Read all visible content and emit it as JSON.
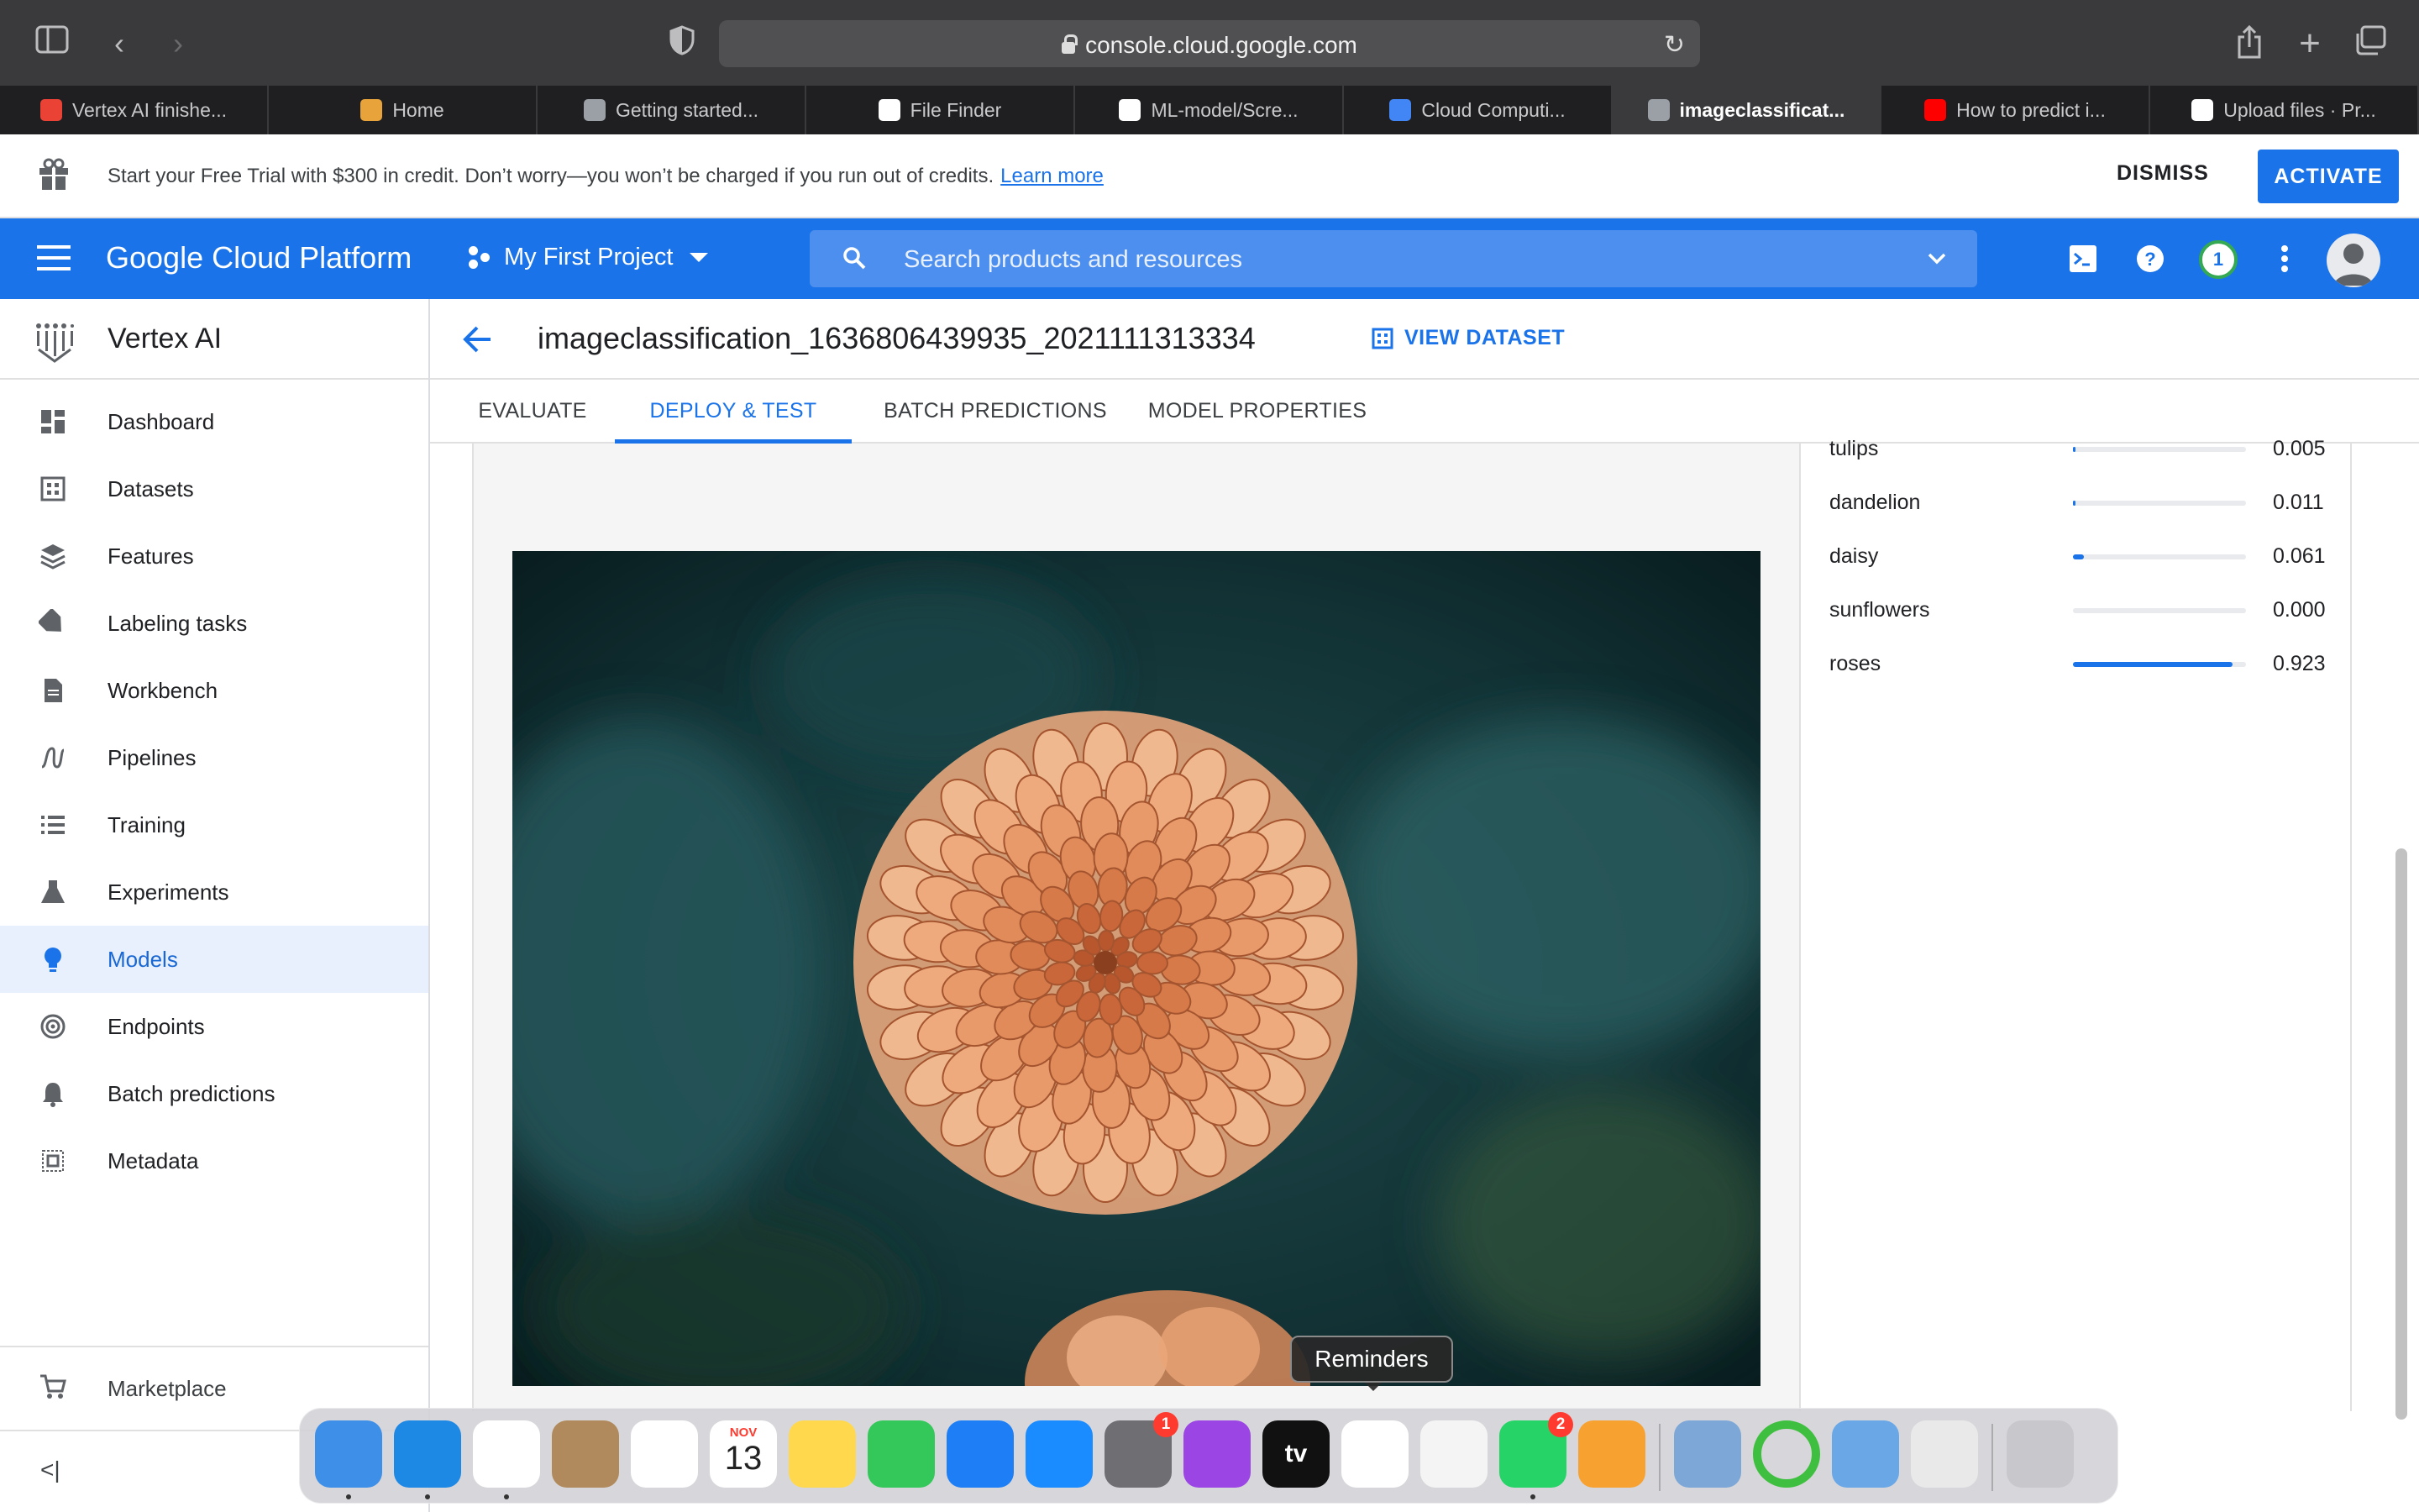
{
  "browser": {
    "url": "console.cloud.google.com",
    "tabs": [
      {
        "label": "Vertex AI finishe...",
        "icon": "gmail-icon",
        "color": "#ea4335"
      },
      {
        "label": "Home",
        "icon": "box-icon",
        "color": "#e8a33a"
      },
      {
        "label": "Getting started...",
        "icon": "gcp-hex-icon",
        "color": "#9aa0a6"
      },
      {
        "label": "File Finder",
        "icon": "github-icon",
        "color": "#ffffff"
      },
      {
        "label": "ML-model/Scre...",
        "icon": "github-icon",
        "color": "#ffffff"
      },
      {
        "label": "Cloud Computi...",
        "icon": "google-cloud-icon",
        "color": "#4285f4"
      },
      {
        "label": "imageclassificat...",
        "icon": "gcp-hex-icon",
        "color": "#9aa0a6",
        "active": true
      },
      {
        "label": "How to predict i...",
        "icon": "youtube-icon",
        "color": "#ff0000"
      },
      {
        "label": "Upload files · Pr...",
        "icon": "github-icon",
        "color": "#ffffff"
      }
    ]
  },
  "banner": {
    "text": "Start your Free Trial with $300 in credit. Don’t worry—you won’t be charged if you run out of credits.",
    "link": "Learn more",
    "dismiss": "DISMISS",
    "activate": "ACTIVATE"
  },
  "header": {
    "brand": "Google Cloud Platform",
    "project": "My First Project",
    "search_placeholder": "Search products and resources",
    "notifications": "1"
  },
  "sidebar": {
    "title": "Vertex AI",
    "items": [
      {
        "label": "Dashboard",
        "icon": "dashboard-icon"
      },
      {
        "label": "Datasets",
        "icon": "datasets-icon"
      },
      {
        "label": "Features",
        "icon": "features-icon"
      },
      {
        "label": "Labeling tasks",
        "icon": "label-icon"
      },
      {
        "label": "Workbench",
        "icon": "notebook-icon"
      },
      {
        "label": "Pipelines",
        "icon": "pipelines-icon"
      },
      {
        "label": "Training",
        "icon": "training-icon"
      },
      {
        "label": "Experiments",
        "icon": "flask-icon"
      },
      {
        "label": "Models",
        "icon": "lightbulb-icon",
        "active": true
      },
      {
        "label": "Endpoints",
        "icon": "endpoints-icon"
      },
      {
        "label": "Batch predictions",
        "icon": "bell-icon"
      },
      {
        "label": "Metadata",
        "icon": "metadata-icon"
      }
    ],
    "marketplace": "Marketplace",
    "collapse": "<|"
  },
  "model": {
    "title": "imageclassification_1636806439935_2021111313334",
    "view_dataset": "VIEW DATASET",
    "tabs": [
      "EVALUATE",
      "DEPLOY & TEST",
      "BATCH PREDICTIONS",
      "MODEL PROPERTIES"
    ],
    "active_tab": "DEPLOY & TEST"
  },
  "predictions": [
    {
      "label": "tulips",
      "value": "0.005",
      "score": 0.005
    },
    {
      "label": "dandelion",
      "value": "0.011",
      "score": 0.011
    },
    {
      "label": "daisy",
      "value": "0.061",
      "score": 0.061
    },
    {
      "label": "sunflowers",
      "value": "0.000",
      "score": 0.0
    },
    {
      "label": "roses",
      "value": "0.923",
      "score": 0.923
    }
  ],
  "dock": {
    "tooltip": "Reminders",
    "calendar_month": "NOV",
    "calendar_day": "13",
    "apps": [
      {
        "name": "finder-icon",
        "color": "#3d8fe8"
      },
      {
        "name": "safari-icon",
        "color": "#1e88e5"
      },
      {
        "name": "chrome-icon",
        "color": "#ffffff"
      },
      {
        "name": "contacts-icon",
        "color": "#b08a5c"
      },
      {
        "name": "photos-icon",
        "color": "#ffffff"
      },
      {
        "name": "calendar-icon",
        "color": "#ffffff"
      },
      {
        "name": "notes-icon",
        "color": "#ffd84d"
      },
      {
        "name": "facetime-icon",
        "color": "#34c759"
      },
      {
        "name": "keynote-icon",
        "color": "#1d7ef5"
      },
      {
        "name": "app-store-icon",
        "color": "#1a8cff"
      },
      {
        "name": "system-preferences-icon",
        "color": "#6e6e73",
        "badge": "1"
      },
      {
        "name": "podcasts-icon",
        "color": "#9b45e4"
      },
      {
        "name": "apple-tv-icon",
        "color": "#111111"
      },
      {
        "name": "reminders-icon",
        "color": "#ffffff"
      },
      {
        "name": "textedit-icon",
        "color": "#f4f4f4"
      },
      {
        "name": "whatsapp-icon",
        "color": "#25d366",
        "badge": "2"
      },
      {
        "name": "pages-icon",
        "color": "#f7a131"
      },
      {
        "name": "preview-icon",
        "color": "#7ca7d6"
      },
      {
        "name": "activity-ring-icon",
        "color": "#3fbf3f"
      },
      {
        "name": "finder-alt-icon",
        "color": "#6aa7e6"
      },
      {
        "name": "downloads-stack-icon",
        "color": "#e9e9ea"
      },
      {
        "name": "trash-icon",
        "color": "#c8c8cc"
      }
    ]
  }
}
